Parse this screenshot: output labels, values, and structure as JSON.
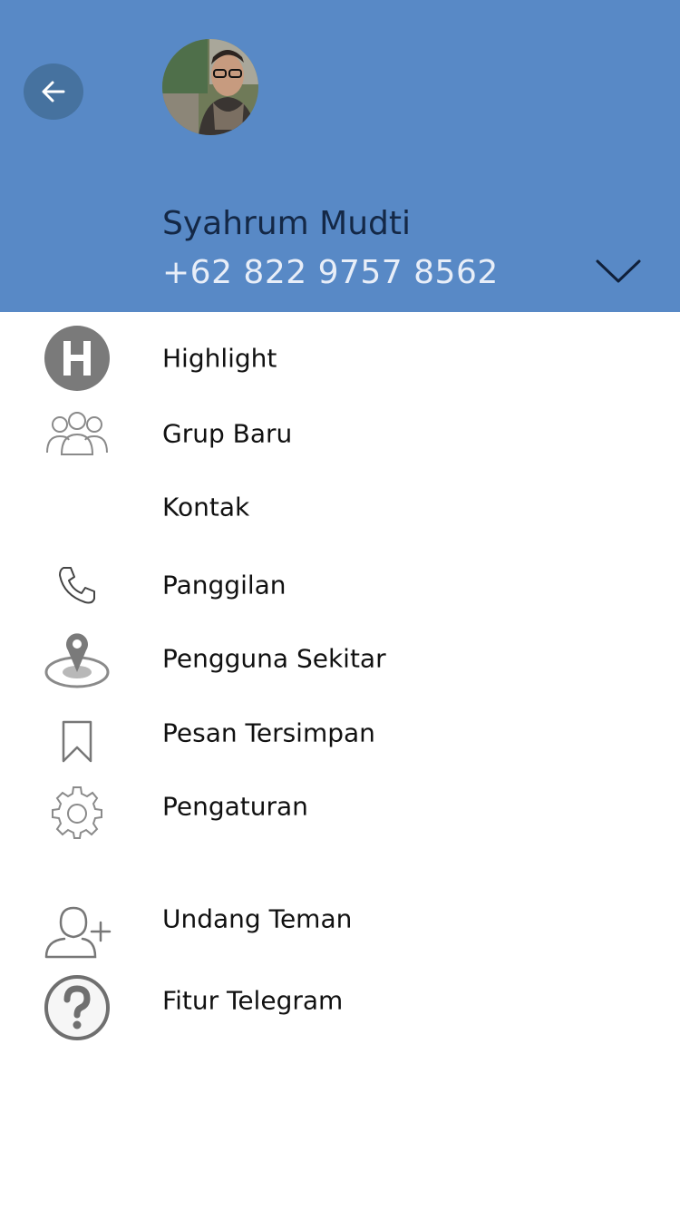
{
  "header": {
    "user_name": "Syahrum Mudti",
    "phone": "+62 822 9757 8562",
    "bg_color": "#5889c6"
  },
  "icons": {
    "back": "back-arrow-icon",
    "expand": "chevron-down-icon"
  },
  "menu": {
    "items": [
      {
        "label": "Highlight",
        "icon": "highlight-h-icon"
      },
      {
        "label": "Grup Baru",
        "icon": "group-icon"
      },
      {
        "label": "Kontak",
        "icon": ""
      },
      {
        "label": "Panggilan",
        "icon": "phone-icon"
      },
      {
        "label": "Pengguna Sekitar",
        "icon": "location-pin-icon"
      },
      {
        "label": "Pesan Tersimpan",
        "icon": "bookmark-icon"
      },
      {
        "label": "Pengaturan",
        "icon": "gear-icon"
      },
      {
        "label": "Undang Teman",
        "icon": "add-user-icon"
      },
      {
        "label": "Fitur Telegram",
        "icon": "help-icon"
      }
    ]
  }
}
